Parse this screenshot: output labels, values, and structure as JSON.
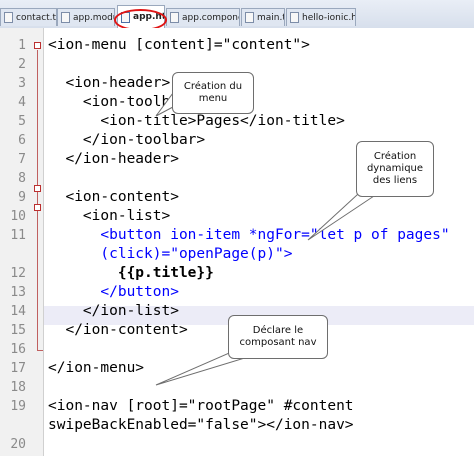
{
  "tabs": [
    {
      "label": "contact.ts",
      "active": false
    },
    {
      "label": "app.module.ts",
      "active": false
    },
    {
      "label": "app.html",
      "active": true
    },
    {
      "label": "app.component.ts",
      "active": false
    },
    {
      "label": "main.ts",
      "active": false
    },
    {
      "label": "hello-ionic.html",
      "active": false
    }
  ],
  "editor": {
    "line_numbers": [
      "1",
      "2",
      "3",
      "4",
      "5",
      "6",
      "7",
      "8",
      "9",
      "10",
      "11",
      "",
      "12",
      "13",
      "14",
      "15",
      "16",
      "17",
      "18",
      "19",
      "",
      "20"
    ],
    "lines": [
      "<ion-menu [content]=\"content\">",
      "",
      "  <ion-header>",
      "    <ion-toolbar>",
      "      <ion-title>Pages</ion-title>",
      "    </ion-toolbar>",
      "  </ion-header>",
      "",
      "  <ion-content>",
      "    <ion-list>",
      "      <button ion-item *ngFor=\"let p of pages\"",
      "      (click)=\"openPage(p)\">",
      "        {{p.title}}",
      "      </button>",
      "    </ion-list>",
      "  </ion-content>",
      "",
      "</ion-menu>",
      "",
      "<ion-nav [root]=\"rootPage\" #content",
      "swipeBackEnabled=\"false\"></ion-nav>",
      ""
    ]
  },
  "callouts": {
    "menu": "Création du menu",
    "links": "Création dynamique des liens",
    "nav": "Déclare le composant nav"
  },
  "colors": {
    "keyword": "#0000ff",
    "string": "#8000ff",
    "tab_highlight": "#e01414"
  }
}
